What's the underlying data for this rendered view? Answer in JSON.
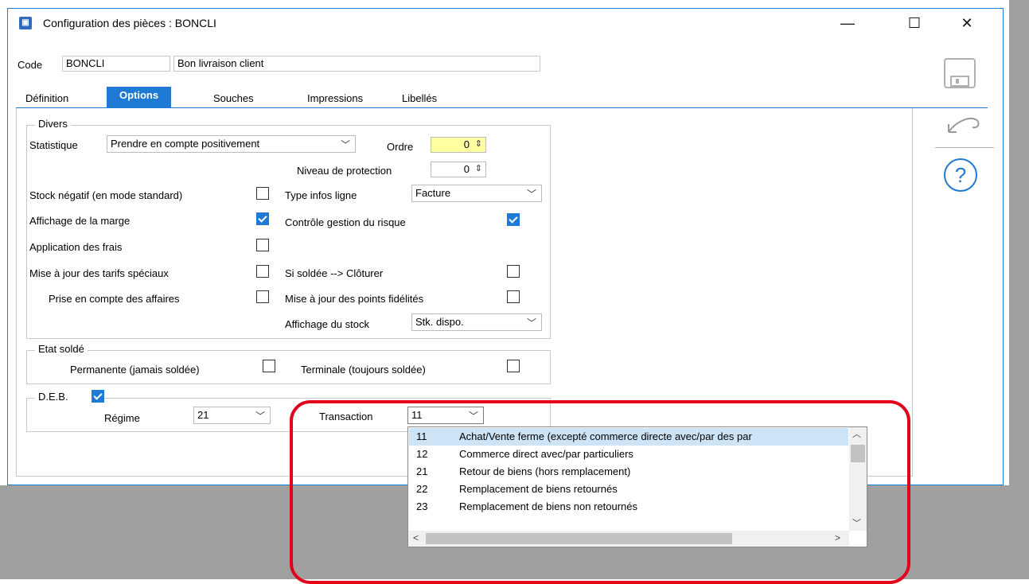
{
  "window": {
    "title": "Configuration des pièces : BONCLI",
    "minimize_icon": "—",
    "maximize_icon": "☐",
    "close_icon": "✕"
  },
  "header": {
    "code_label": "Code",
    "code_value": "BONCLI",
    "description_value": "Bon livraison client"
  },
  "tabs": [
    {
      "label": "Définition"
    },
    {
      "label": "Options",
      "active": true
    },
    {
      "label": "Souches"
    },
    {
      "label": "Impressions"
    },
    {
      "label": "Libellés"
    }
  ],
  "divers": {
    "title": "Divers",
    "statistique_label": "Statistique",
    "statistique_value": "Prendre en compte positivement",
    "ordre_label": "Ordre",
    "ordre_value": "0",
    "niveau_label": "Niveau de protection",
    "niveau_value": "0",
    "stock_negatif_label": "Stock négatif (en mode standard)",
    "stock_negatif_checked": false,
    "type_infos_label": "Type infos ligne",
    "type_infos_value": "Facture",
    "affichage_marge_label": "Affichage de la marge",
    "affichage_marge_checked": true,
    "controle_risque_label": "Contrôle gestion du risque",
    "controle_risque_checked": true,
    "application_frais_label": "Application des frais",
    "application_frais_checked": false,
    "maj_tarifs_label": "Mise à jour des tarifs spéciaux",
    "maj_tarifs_checked": false,
    "si_soldee_label": "Si soldée --> Clôturer",
    "si_soldee_checked": false,
    "prise_affaires_label": "Prise en compte des affaires",
    "prise_affaires_checked": false,
    "maj_points_label": "Mise à jour des points fidélités",
    "maj_points_checked": false,
    "affichage_stock_label": "Affichage du stock",
    "affichage_stock_value": "Stk. dispo."
  },
  "etat_solde": {
    "title": "Etat soldé",
    "permanente_label": "Permanente (jamais soldée)",
    "permanente_checked": false,
    "terminale_label": "Terminale (toujours soldée)",
    "terminale_checked": false
  },
  "deb": {
    "title": "D.E.B.",
    "checked": true,
    "regime_label": "Régime",
    "regime_value": "21",
    "transaction_label": "Transaction",
    "transaction_value": "11"
  },
  "transaction_options": [
    {
      "code": "11",
      "text": "Achat/Vente ferme (excepté commerce directe avec/par des par",
      "selected": true
    },
    {
      "code": "12",
      "text": "Commerce direct avec/par particuliers"
    },
    {
      "code": "21",
      "text": "Retour de biens (hors remplacement)"
    },
    {
      "code": "22",
      "text": "Remplacement de biens retournés"
    },
    {
      "code": "23",
      "text": "Remplacement de biens non retournés"
    }
  ],
  "colors": {
    "accent": "#1e7ad4",
    "highlight": "#e3001b",
    "selected_row": "#cde4f7",
    "ordre_field": "#ffffa0"
  }
}
